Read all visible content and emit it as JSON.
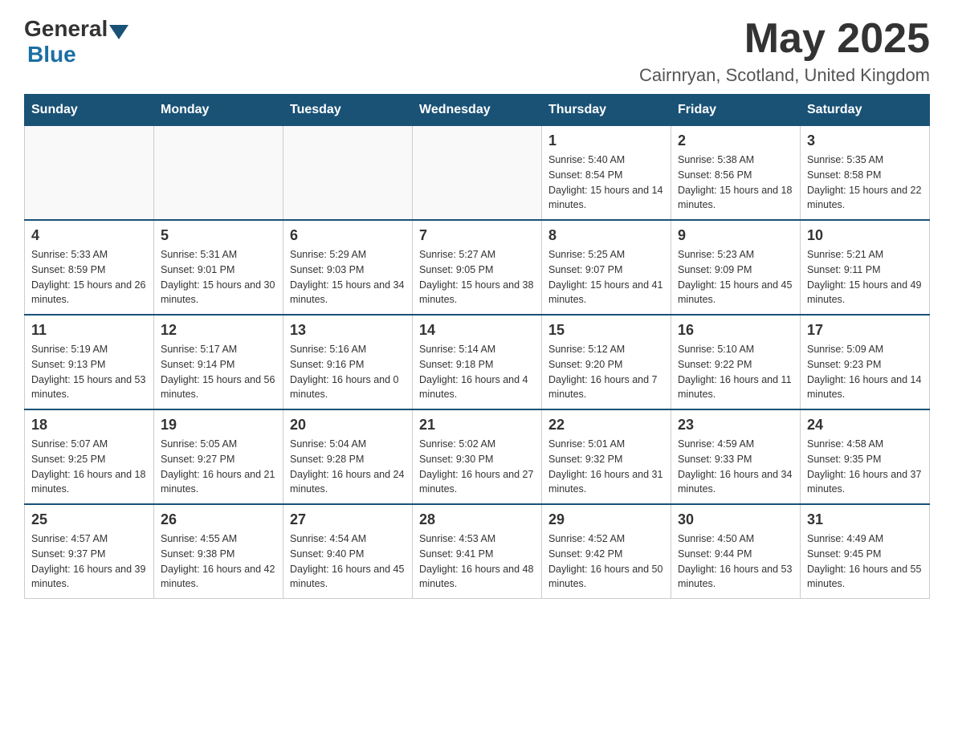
{
  "header": {
    "logo_general": "General",
    "logo_blue": "Blue",
    "month_year": "May 2025",
    "location": "Cairnryan, Scotland, United Kingdom"
  },
  "days_of_week": [
    "Sunday",
    "Monday",
    "Tuesday",
    "Wednesday",
    "Thursday",
    "Friday",
    "Saturday"
  ],
  "weeks": [
    {
      "days": [
        {
          "number": "",
          "sunrise": "",
          "sunset": "",
          "daylight": "",
          "empty": true
        },
        {
          "number": "",
          "sunrise": "",
          "sunset": "",
          "daylight": "",
          "empty": true
        },
        {
          "number": "",
          "sunrise": "",
          "sunset": "",
          "daylight": "",
          "empty": true
        },
        {
          "number": "",
          "sunrise": "",
          "sunset": "",
          "daylight": "",
          "empty": true
        },
        {
          "number": "1",
          "sunrise": "Sunrise: 5:40 AM",
          "sunset": "Sunset: 8:54 PM",
          "daylight": "Daylight: 15 hours and 14 minutes.",
          "empty": false
        },
        {
          "number": "2",
          "sunrise": "Sunrise: 5:38 AM",
          "sunset": "Sunset: 8:56 PM",
          "daylight": "Daylight: 15 hours and 18 minutes.",
          "empty": false
        },
        {
          "number": "3",
          "sunrise": "Sunrise: 5:35 AM",
          "sunset": "Sunset: 8:58 PM",
          "daylight": "Daylight: 15 hours and 22 minutes.",
          "empty": false
        }
      ]
    },
    {
      "days": [
        {
          "number": "4",
          "sunrise": "Sunrise: 5:33 AM",
          "sunset": "Sunset: 8:59 PM",
          "daylight": "Daylight: 15 hours and 26 minutes.",
          "empty": false
        },
        {
          "number": "5",
          "sunrise": "Sunrise: 5:31 AM",
          "sunset": "Sunset: 9:01 PM",
          "daylight": "Daylight: 15 hours and 30 minutes.",
          "empty": false
        },
        {
          "number": "6",
          "sunrise": "Sunrise: 5:29 AM",
          "sunset": "Sunset: 9:03 PM",
          "daylight": "Daylight: 15 hours and 34 minutes.",
          "empty": false
        },
        {
          "number": "7",
          "sunrise": "Sunrise: 5:27 AM",
          "sunset": "Sunset: 9:05 PM",
          "daylight": "Daylight: 15 hours and 38 minutes.",
          "empty": false
        },
        {
          "number": "8",
          "sunrise": "Sunrise: 5:25 AM",
          "sunset": "Sunset: 9:07 PM",
          "daylight": "Daylight: 15 hours and 41 minutes.",
          "empty": false
        },
        {
          "number": "9",
          "sunrise": "Sunrise: 5:23 AM",
          "sunset": "Sunset: 9:09 PM",
          "daylight": "Daylight: 15 hours and 45 minutes.",
          "empty": false
        },
        {
          "number": "10",
          "sunrise": "Sunrise: 5:21 AM",
          "sunset": "Sunset: 9:11 PM",
          "daylight": "Daylight: 15 hours and 49 minutes.",
          "empty": false
        }
      ]
    },
    {
      "days": [
        {
          "number": "11",
          "sunrise": "Sunrise: 5:19 AM",
          "sunset": "Sunset: 9:13 PM",
          "daylight": "Daylight: 15 hours and 53 minutes.",
          "empty": false
        },
        {
          "number": "12",
          "sunrise": "Sunrise: 5:17 AM",
          "sunset": "Sunset: 9:14 PM",
          "daylight": "Daylight: 15 hours and 56 minutes.",
          "empty": false
        },
        {
          "number": "13",
          "sunrise": "Sunrise: 5:16 AM",
          "sunset": "Sunset: 9:16 PM",
          "daylight": "Daylight: 16 hours and 0 minutes.",
          "empty": false
        },
        {
          "number": "14",
          "sunrise": "Sunrise: 5:14 AM",
          "sunset": "Sunset: 9:18 PM",
          "daylight": "Daylight: 16 hours and 4 minutes.",
          "empty": false
        },
        {
          "number": "15",
          "sunrise": "Sunrise: 5:12 AM",
          "sunset": "Sunset: 9:20 PM",
          "daylight": "Daylight: 16 hours and 7 minutes.",
          "empty": false
        },
        {
          "number": "16",
          "sunrise": "Sunrise: 5:10 AM",
          "sunset": "Sunset: 9:22 PM",
          "daylight": "Daylight: 16 hours and 11 minutes.",
          "empty": false
        },
        {
          "number": "17",
          "sunrise": "Sunrise: 5:09 AM",
          "sunset": "Sunset: 9:23 PM",
          "daylight": "Daylight: 16 hours and 14 minutes.",
          "empty": false
        }
      ]
    },
    {
      "days": [
        {
          "number": "18",
          "sunrise": "Sunrise: 5:07 AM",
          "sunset": "Sunset: 9:25 PM",
          "daylight": "Daylight: 16 hours and 18 minutes.",
          "empty": false
        },
        {
          "number": "19",
          "sunrise": "Sunrise: 5:05 AM",
          "sunset": "Sunset: 9:27 PM",
          "daylight": "Daylight: 16 hours and 21 minutes.",
          "empty": false
        },
        {
          "number": "20",
          "sunrise": "Sunrise: 5:04 AM",
          "sunset": "Sunset: 9:28 PM",
          "daylight": "Daylight: 16 hours and 24 minutes.",
          "empty": false
        },
        {
          "number": "21",
          "sunrise": "Sunrise: 5:02 AM",
          "sunset": "Sunset: 9:30 PM",
          "daylight": "Daylight: 16 hours and 27 minutes.",
          "empty": false
        },
        {
          "number": "22",
          "sunrise": "Sunrise: 5:01 AM",
          "sunset": "Sunset: 9:32 PM",
          "daylight": "Daylight: 16 hours and 31 minutes.",
          "empty": false
        },
        {
          "number": "23",
          "sunrise": "Sunrise: 4:59 AM",
          "sunset": "Sunset: 9:33 PM",
          "daylight": "Daylight: 16 hours and 34 minutes.",
          "empty": false
        },
        {
          "number": "24",
          "sunrise": "Sunrise: 4:58 AM",
          "sunset": "Sunset: 9:35 PM",
          "daylight": "Daylight: 16 hours and 37 minutes.",
          "empty": false
        }
      ]
    },
    {
      "days": [
        {
          "number": "25",
          "sunrise": "Sunrise: 4:57 AM",
          "sunset": "Sunset: 9:37 PM",
          "daylight": "Daylight: 16 hours and 39 minutes.",
          "empty": false
        },
        {
          "number": "26",
          "sunrise": "Sunrise: 4:55 AM",
          "sunset": "Sunset: 9:38 PM",
          "daylight": "Daylight: 16 hours and 42 minutes.",
          "empty": false
        },
        {
          "number": "27",
          "sunrise": "Sunrise: 4:54 AM",
          "sunset": "Sunset: 9:40 PM",
          "daylight": "Daylight: 16 hours and 45 minutes.",
          "empty": false
        },
        {
          "number": "28",
          "sunrise": "Sunrise: 4:53 AM",
          "sunset": "Sunset: 9:41 PM",
          "daylight": "Daylight: 16 hours and 48 minutes.",
          "empty": false
        },
        {
          "number": "29",
          "sunrise": "Sunrise: 4:52 AM",
          "sunset": "Sunset: 9:42 PM",
          "daylight": "Daylight: 16 hours and 50 minutes.",
          "empty": false
        },
        {
          "number": "30",
          "sunrise": "Sunrise: 4:50 AM",
          "sunset": "Sunset: 9:44 PM",
          "daylight": "Daylight: 16 hours and 53 minutes.",
          "empty": false
        },
        {
          "number": "31",
          "sunrise": "Sunrise: 4:49 AM",
          "sunset": "Sunset: 9:45 PM",
          "daylight": "Daylight: 16 hours and 55 minutes.",
          "empty": false
        }
      ]
    }
  ]
}
